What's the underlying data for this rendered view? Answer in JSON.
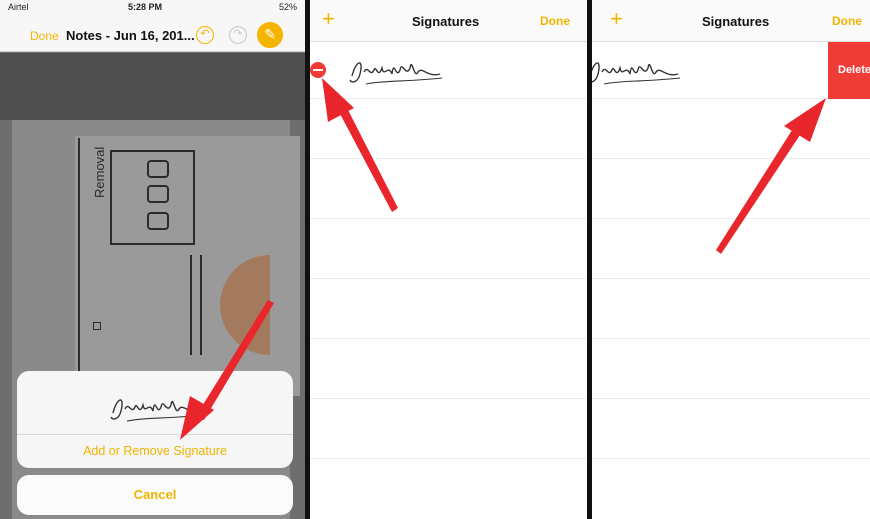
{
  "panel1": {
    "status": {
      "carrier": "Airtel",
      "time": "5:28 PM",
      "battery": "52%"
    },
    "nav": {
      "done": "Done",
      "title": "Notes - Jun 16, 201..."
    },
    "doc": {
      "heading": "Removal"
    },
    "sheet": {
      "signature": "Jignesh",
      "add_remove": "Add or Remove Signature"
    },
    "cancel": "Cancel"
  },
  "panel2": {
    "plus": "+",
    "title": "Signatures",
    "done": "Done",
    "signature": "Jignesh"
  },
  "panel3": {
    "plus": "+",
    "title": "Signatures",
    "done": "Done",
    "signature": "Jignesh",
    "delete": "Delete"
  },
  "colors": {
    "accent": "#f0b400",
    "delete_red": "#f03c36",
    "arrow_red": "#e8262b"
  }
}
